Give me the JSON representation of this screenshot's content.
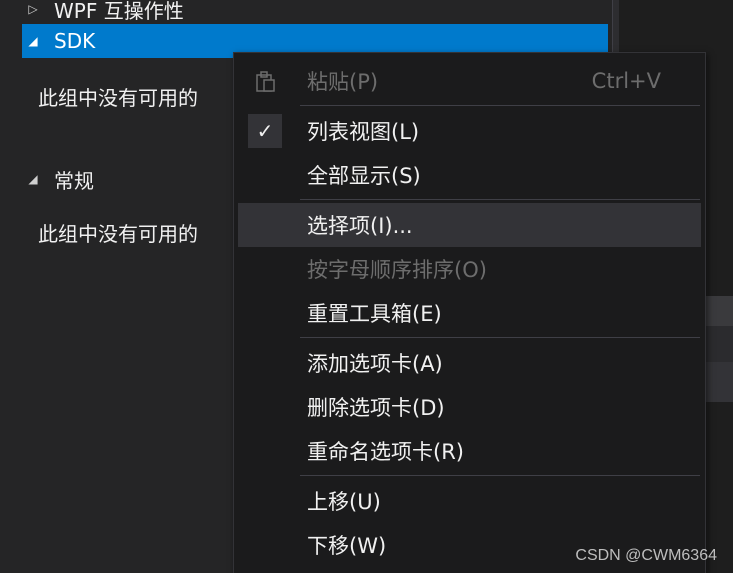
{
  "toolbox": {
    "groups": [
      {
        "label": "WPF 互操作性",
        "expanded": false
      },
      {
        "label": "SDK",
        "expanded": true,
        "empty_text": "此组中没有可用的"
      },
      {
        "label": "常规",
        "expanded": true,
        "empty_text": "此组中没有可用的"
      }
    ]
  },
  "context_menu": {
    "items": [
      {
        "label": "粘贴(P)",
        "shortcut": "Ctrl+V",
        "disabled": true,
        "icon": "paste-icon"
      },
      {
        "label": "列表视图(L)",
        "checked": true,
        "icon": "check-icon"
      },
      {
        "label": "全部显示(S)"
      },
      {
        "label": "选择项(I)...",
        "hovered": true
      },
      {
        "label": "按字母顺序排序(O)",
        "disabled": true
      },
      {
        "label": "重置工具箱(E)"
      },
      {
        "label": "添加选项卡(A)"
      },
      {
        "label": "删除选项卡(D)"
      },
      {
        "label": "重命名选项卡(R)"
      },
      {
        "label": "上移(U)"
      },
      {
        "label": "下移(W)"
      }
    ]
  },
  "watermark": "CSDN @CWM6364",
  "colors": {
    "selection": "#007acc",
    "menu_bg": "#1b1b1c",
    "hover": "#333337",
    "disabled_text": "#6d6d6d"
  }
}
